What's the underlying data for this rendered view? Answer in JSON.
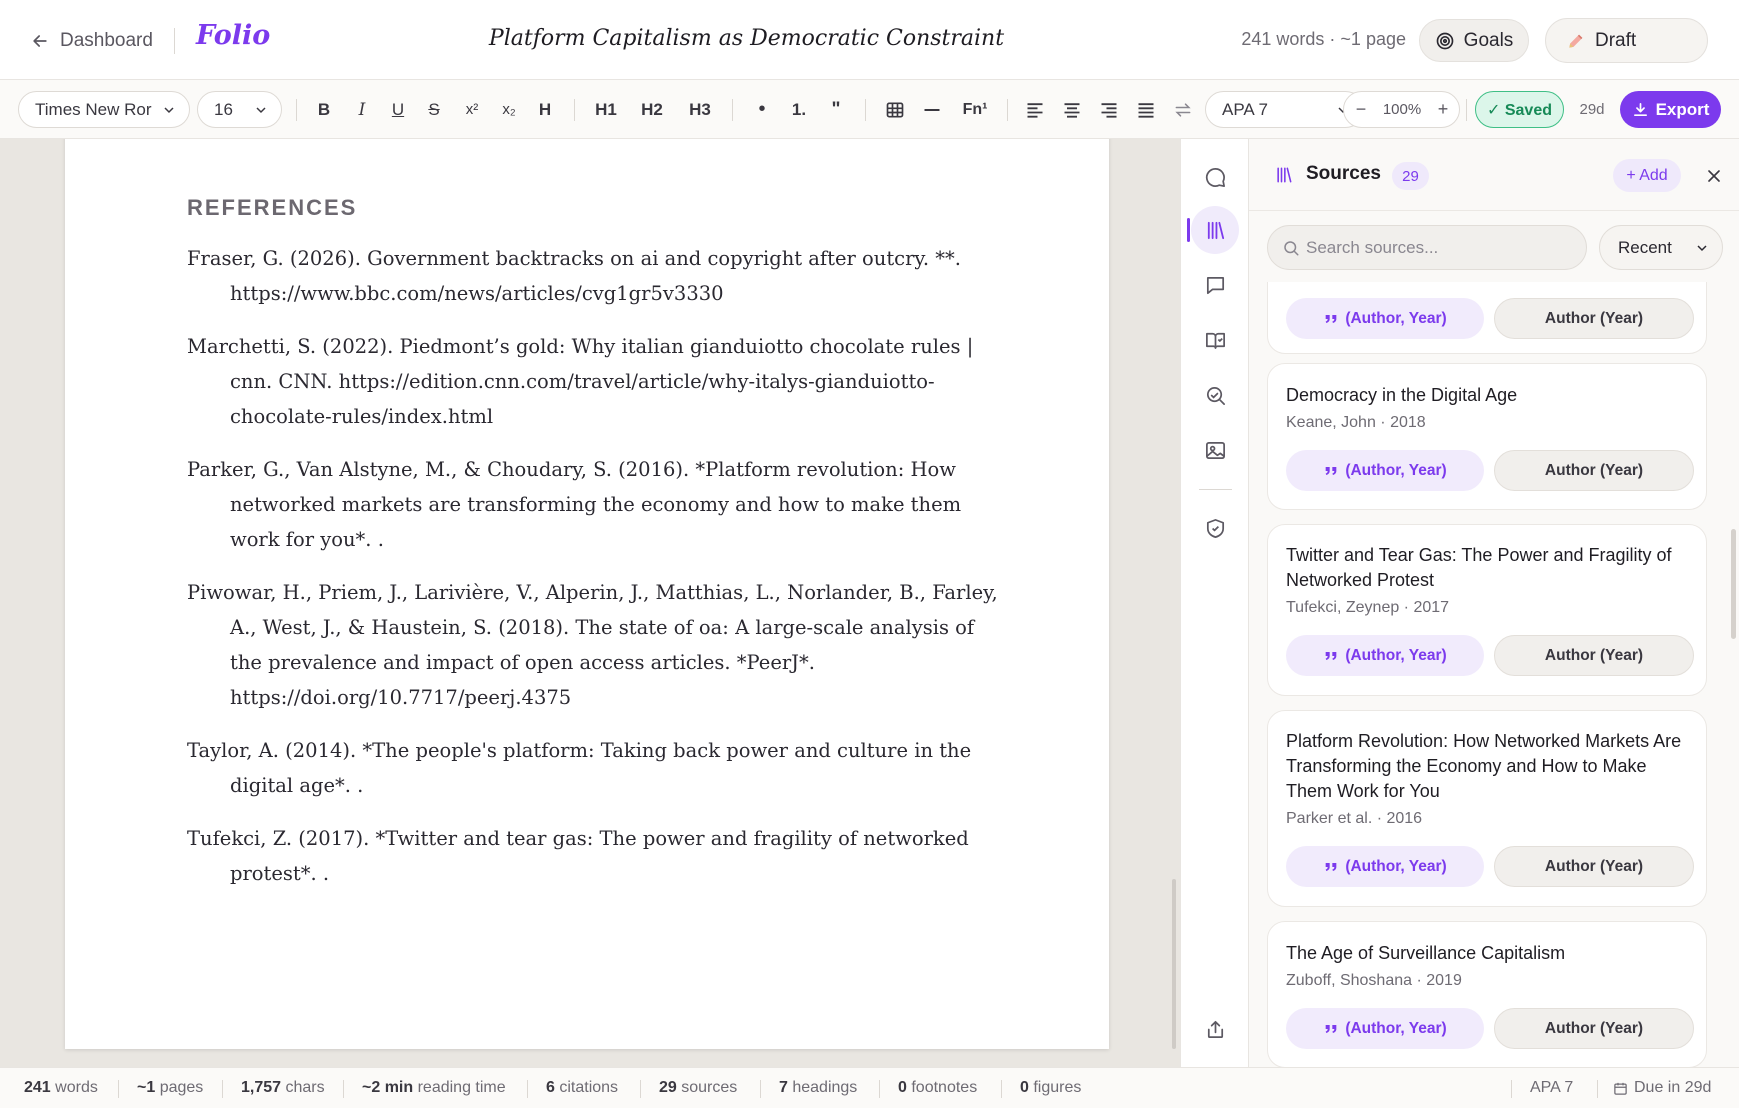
{
  "header": {
    "back_label": "Dashboard",
    "brand": "Folio",
    "doc_title": "Platform Capitalism as Democratic Constraint",
    "word_meta": "241 words · ~1 page",
    "goals_label": "Goals",
    "draft_label": "Draft"
  },
  "toolbar": {
    "font_family": "Times New Ror",
    "font_size": "16",
    "bold": "B",
    "italic": "I",
    "underline": "U",
    "strike": "S",
    "superscript": "x²",
    "subscript": "x₂",
    "highlight": "H",
    "h1": "H1",
    "h2": "H2",
    "h3": "H3",
    "bullet_list": "•",
    "numbered_list": "1.",
    "quote": "\"",
    "footnote": "Fn¹",
    "citation_style": "APA 7",
    "zoom_minus": "−",
    "zoom": "100%",
    "zoom_plus": "+",
    "saved_label": "✓ Saved",
    "days_left": "29d",
    "export_label": "Export"
  },
  "document": {
    "references_heading": "REFERENCES",
    "references": [
      "Fraser, G. (2026). Government backtracks on ai and copyright after outcry. **. https://www.bbc.com/news/articles/cvg1gr5v3330",
      "Marchetti, S. (2022). Piedmont’s gold: Why italian gianduiotto chocolate rules | cnn. CNN. https://edition.cnn.com/travel/article/why-italys-gianduiotto-chocolate-rules/index.html",
      "Parker, G., Van Alstyne, M., & Choudary, S. (2016). *Platform revolution: How networked markets are transforming the economy and how to make them work for you*. .",
      "Piwowar, H., Priem, J., Larivière, V., Alperin, J., Matthias, L., Norlander, B., Farley, A., West, J., & Haustein, S. (2018). The state of oa: A large-scale analysis of the prevalence and impact of open access articles. *PeerJ*. https://doi.org/10.7717/peerj.4375",
      "Taylor, A. (2014). *The people's platform: Taking back power and culture in the digital age*. .",
      "Tufekci, Z. (2017). *Twitter and tear gas: The power and fragility of networked protest*. ."
    ]
  },
  "sources_panel": {
    "title": "Sources",
    "count": "29",
    "add_label": "+ Add",
    "search_placeholder": "Search sources...",
    "sort": "Recent",
    "cite_parenthetical": "(Author, Year)",
    "cite_narrative": "Author (Year)",
    "cards": [
      {
        "title": "",
        "meta": ""
      },
      {
        "title": "Democracy in the Digital Age",
        "meta": "Keane, John · 2018"
      },
      {
        "title": "Twitter and Tear Gas: The Power and Fragility of Networked Protest",
        "meta": "Tufekci, Zeynep · 2017"
      },
      {
        "title": "Platform Revolution: How Networked Markets Are Transforming the Economy and How to Make Them Work for You",
        "meta": "Parker et al. · 2016"
      },
      {
        "title": "The Age of Surveillance Capitalism",
        "meta": "Zuboff, Shoshana · 2019"
      }
    ]
  },
  "statusbar": {
    "words_n": "241",
    "words_l": "words",
    "pages_n": "~1",
    "pages_l": "pages",
    "chars_n": "1,757",
    "chars_l": "chars",
    "reading_n": "~2 min",
    "reading_l": "reading time",
    "citations_n": "6",
    "citations_l": "citations",
    "sources_n": "29",
    "sources_l": "sources",
    "headings_n": "7",
    "headings_l": "headings",
    "footnotes_n": "0",
    "footnotes_l": "footnotes",
    "figures_n": "0",
    "figures_l": "figures",
    "style": "APA 7",
    "due": "Due in 29d"
  },
  "colors": {
    "accent": "#7c3aed",
    "saved_green": "#178a57",
    "brand": "#7c3aed"
  },
  "icons": {
    "rail": [
      "comment-icon",
      "library-icon",
      "chat-icon",
      "reading-icon",
      "search-zoom-icon",
      "image-icon",
      "shield-check-icon",
      "share-icon"
    ]
  }
}
